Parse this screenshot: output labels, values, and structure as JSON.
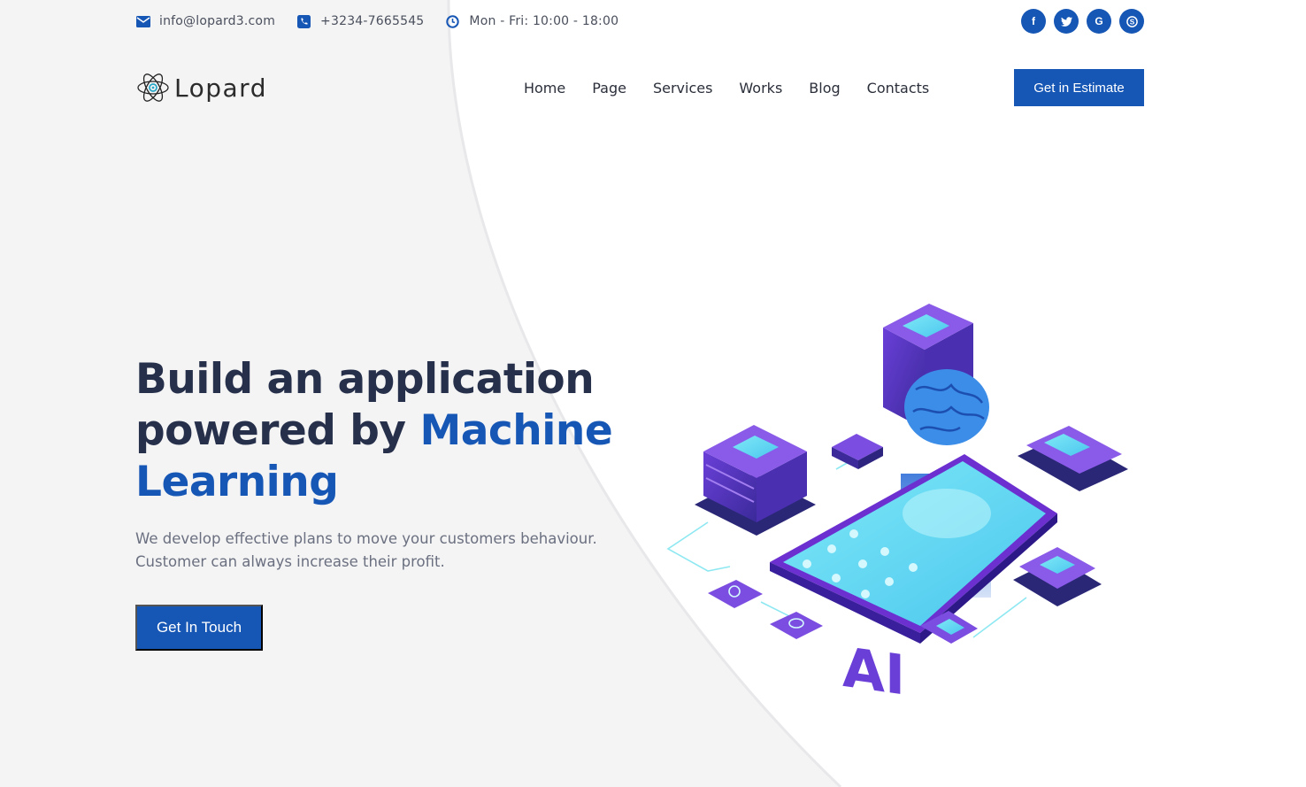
{
  "colors": {
    "accent": "#1656b5",
    "text": "#26304a",
    "muted": "#6b7080"
  },
  "topbar": {
    "email": {
      "icon": "envelope-icon",
      "text": "info@lopard3.com"
    },
    "phone": {
      "icon": "phone-icon",
      "text": "+3234-7665545"
    },
    "hours": {
      "icon": "clock-icon",
      "text": "Mon - Fri: 10:00 - 18:00"
    },
    "socials": [
      {
        "icon": "facebook-icon",
        "glyph": "f"
      },
      {
        "icon": "twitter-icon",
        "glyph": "t"
      },
      {
        "icon": "google-icon",
        "glyph": "G"
      },
      {
        "icon": "skype-icon",
        "glyph": "S"
      }
    ]
  },
  "header": {
    "logo_text": "Lopard",
    "nav": [
      "Home",
      "Page",
      "Services",
      "Works",
      "Blog",
      "Contacts"
    ],
    "cta_label": "Get in Estimate"
  },
  "hero": {
    "title_line1": "Build an application",
    "title_line2_plain": "powered by ",
    "title_line2_accent": "Machine",
    "title_line3_accent": "Learning",
    "description_line1": "We develop effective plans to move your customers behaviour.",
    "description_line2": "Customer can always increase their profit.",
    "button_label": "Get In Touch",
    "illustration_text": "AI"
  }
}
